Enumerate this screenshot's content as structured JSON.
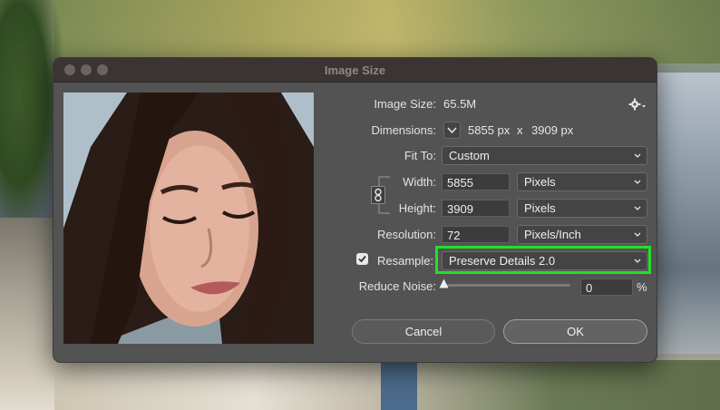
{
  "dialog": {
    "title": "Image Size",
    "image_size_label": "Image Size:",
    "image_size_value": "65.5M",
    "dimensions_label": "Dimensions:",
    "dimensions_w": "5855 px",
    "dimensions_x": "x",
    "dimensions_h": "3909 px",
    "fit_to_label": "Fit To:",
    "fit_to_value": "Custom",
    "width_label": "Width:",
    "width_value": "5855",
    "width_unit": "Pixels",
    "height_label": "Height:",
    "height_value": "3909",
    "height_unit": "Pixels",
    "resolution_label": "Resolution:",
    "resolution_value": "72",
    "resolution_unit": "Pixels/Inch",
    "resample_label": "Resample:",
    "resample_checked": true,
    "resample_value": "Preserve Details 2.0",
    "reduce_noise_label": "Reduce Noise:",
    "reduce_noise_value": "0",
    "reduce_noise_unit": "%",
    "cancel_label": "Cancel",
    "ok_label": "OK"
  },
  "colors": {
    "highlight": "#22e02a",
    "dialog_bg": "#535353",
    "titlebar_bg": "#3b3433"
  },
  "icons": [
    "gear-icon",
    "chevron-down-icon",
    "link-chain-icon",
    "checkbox-icon",
    "slider-handle-icon"
  ]
}
